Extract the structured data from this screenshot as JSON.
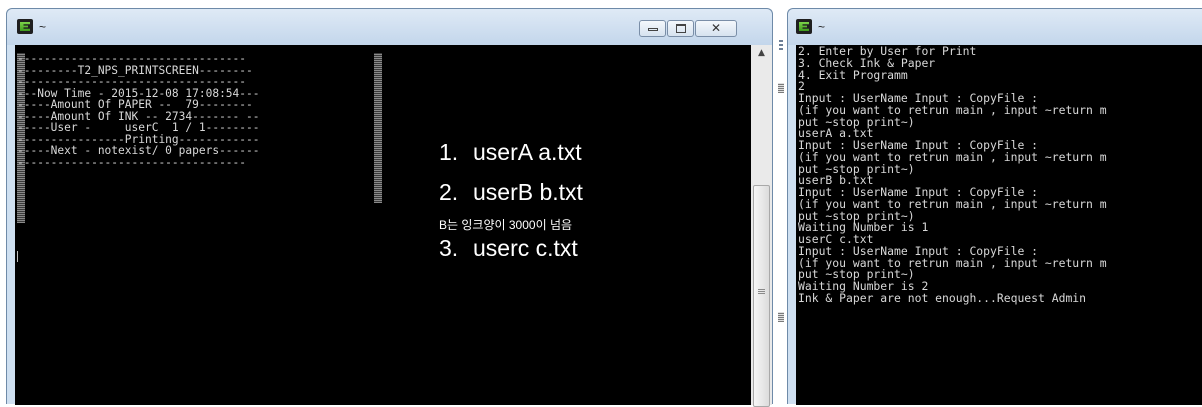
{
  "left_window": {
    "title": "~",
    "close_glyph": "✕",
    "print_screen_lines": [
      "----------------------------------",
      "---------T2_NPS_PRINTSCREEN--------",
      "----------------------------------",
      "---Now Time - 2015-12-08 17:08:54---",
      "-----Amount Of PAPER --  79--------",
      "-----Amount Of INK -- 2734------- --",
      "-----User -     userC  1 / 1--------",
      "----------------Printing------------",
      "-----Next - notexist/ 0 papers------",
      "----------------------------------"
    ],
    "annotations": {
      "item1_num": "1.",
      "item1_text": "userA a.txt",
      "item2_num": "2.",
      "item2_text": "userB b.txt",
      "note": "B는 잉크양이 3000이 넘음",
      "item3_num": "3.",
      "item3_text": "userc c.txt"
    },
    "scroll_up_glyph": "▲"
  },
  "right_window": {
    "title": "~",
    "output_lines": [
      "2. Enter by User for Print",
      "3. Check Ink & Paper",
      "4. Exit Programm",
      "2",
      "Input : UserName Input : CopyFile :",
      "(if you want to retrun main , input ~return m",
      "put ~stop print~)",
      "userA a.txt",
      "Input : UserName Input : CopyFile :",
      "(if you want to retrun main , input ~return m",
      "put ~stop print~)",
      "userB b.txt",
      "Input : UserName Input : CopyFile :",
      "(if you want to retrun main , input ~return m",
      "put ~stop print~)",
      "Waiting Number is 1",
      "userC c.txt",
      "Input : UserName Input : CopyFile :",
      "(if you want to retrun main , input ~return m",
      "put ~stop print~)",
      "Waiting Number is 2",
      "Ink & Paper are not enough...Request Admin"
    ]
  }
}
